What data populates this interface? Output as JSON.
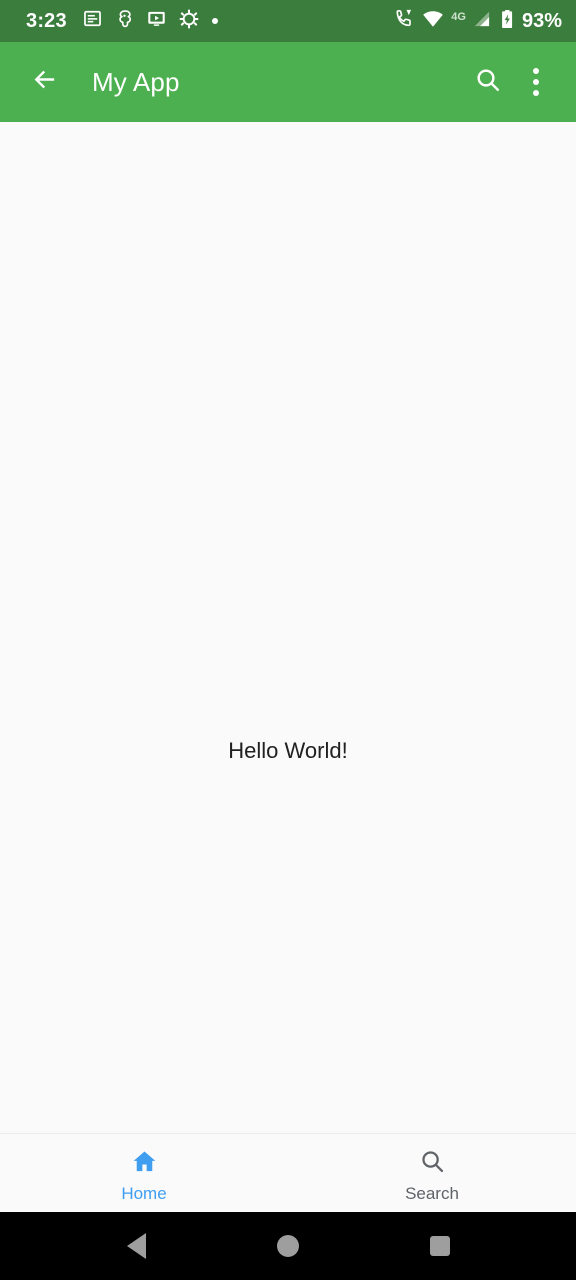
{
  "status_bar": {
    "clock": "3:23",
    "battery_percent": "93%",
    "network_label": "4G",
    "background_color": "#3b7d3c",
    "foreground_color": "#ffffff",
    "left_icons": [
      {
        "name": "notes-notification-icon"
      },
      {
        "name": "adb-debug-icon"
      },
      {
        "name": "screencast-icon"
      },
      {
        "name": "brightness-gear-icon"
      },
      {
        "name": "more-notifications-dot-icon"
      }
    ],
    "right_icons": [
      {
        "name": "volte-call-icon"
      },
      {
        "name": "wifi-icon"
      },
      {
        "name": "cellular-signal-icon"
      },
      {
        "name": "battery-charging-icon"
      }
    ]
  },
  "app_bar": {
    "title": "My App",
    "background_color": "#4caf50",
    "back_icon": "arrow-back-icon",
    "search_icon": "search-icon",
    "overflow_icon": "more-vert-icon"
  },
  "content": {
    "background_color": "#fafafa",
    "message": "Hello World!",
    "message_color": "#212121"
  },
  "bottom_nav": {
    "background_color": "#fafafa",
    "selected_color": "#3f9ef0",
    "unselected_color": "#5f6368",
    "items": [
      {
        "label": "Home",
        "icon": "home-icon",
        "selected": true
      },
      {
        "label": "Search",
        "icon": "search-icon",
        "selected": false
      }
    ]
  },
  "system_nav": {
    "background_color": "#000000",
    "icon_color": "#9e9e9e",
    "buttons": [
      {
        "name": "system-back-button"
      },
      {
        "name": "system-home-button"
      },
      {
        "name": "system-recents-button"
      }
    ]
  }
}
